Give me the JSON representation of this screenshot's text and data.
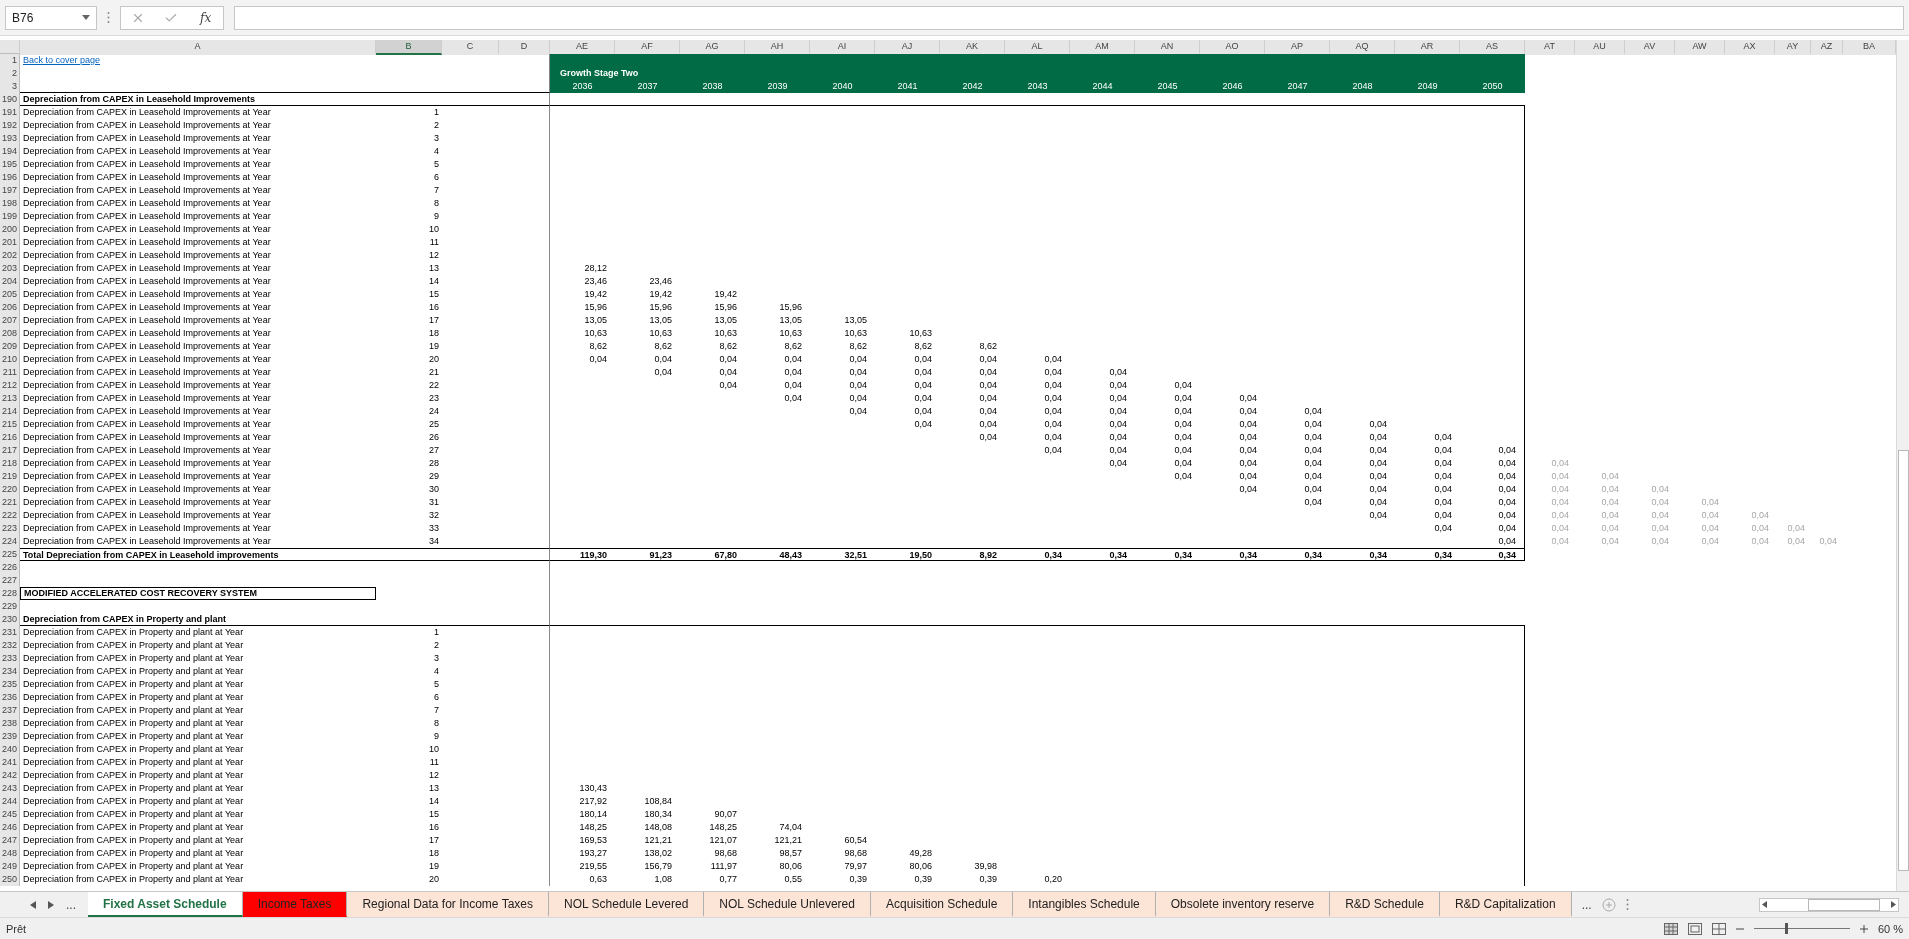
{
  "name_box": "B76",
  "formula_bar": {
    "function_button": "fx"
  },
  "column_headers": [
    {
      "label": "A",
      "selected": false
    },
    {
      "label": "B",
      "selected": true
    },
    {
      "label": "C",
      "selected": false
    },
    {
      "label": "D",
      "selected": false
    },
    {
      "label": "AE",
      "selected": false
    },
    {
      "label": "AF",
      "selected": false
    },
    {
      "label": "AG",
      "selected": false
    },
    {
      "label": "AH",
      "selected": false
    },
    {
      "label": "AI",
      "selected": false
    },
    {
      "label": "AJ",
      "selected": false
    },
    {
      "label": "AK",
      "selected": false
    },
    {
      "label": "AL",
      "selected": false
    },
    {
      "label": "AM",
      "selected": false
    },
    {
      "label": "AN",
      "selected": false
    },
    {
      "label": "AO",
      "selected": false
    },
    {
      "label": "AP",
      "selected": false
    },
    {
      "label": "AQ",
      "selected": false
    },
    {
      "label": "AR",
      "selected": false
    },
    {
      "label": "AS",
      "selected": false
    },
    {
      "label": "AT",
      "selected": false
    },
    {
      "label": "AU",
      "selected": false
    },
    {
      "label": "AV",
      "selected": false
    },
    {
      "label": "AW",
      "selected": false
    },
    {
      "label": "AX",
      "selected": false
    },
    {
      "label": "AY",
      "selected": false
    },
    {
      "label": "AZ",
      "selected": false
    },
    {
      "label": "BA",
      "selected": false
    }
  ],
  "rows": [
    {
      "row_number": "1",
      "kind": "link",
      "text": "Back to cover page"
    },
    {
      "row_number": "2",
      "kind": "band_title",
      "text": "Growth Stage Two"
    },
    {
      "row_number": "3",
      "kind": "band_years",
      "values": [
        "2036",
        "2037",
        "2038",
        "2039",
        "2040",
        "2041",
        "2042",
        "2043",
        "2044",
        "2045",
        "2046",
        "2047",
        "2048",
        "2049",
        "2050"
      ]
    },
    {
      "row_number": "190",
      "kind": "section",
      "text": "Depreciation from CAPEX in Leasehold Improvements"
    },
    {
      "row_number": "191",
      "kind": "item",
      "label": "Depreciation from CAPEX in Leasehold Improvements at Year",
      "year": "1"
    },
    {
      "row_number": "192",
      "kind": "item",
      "label": "Depreciation from CAPEX in Leasehold Improvements at Year",
      "year": "2"
    },
    {
      "row_number": "193",
      "kind": "item",
      "label": "Depreciation from CAPEX in Leasehold Improvements at Year",
      "year": "3"
    },
    {
      "row_number": "194",
      "kind": "item",
      "label": "Depreciation from CAPEX in Leasehold Improvements at Year",
      "year": "4"
    },
    {
      "row_number": "195",
      "kind": "item",
      "label": "Depreciation from CAPEX in Leasehold Improvements at Year",
      "year": "5"
    },
    {
      "row_number": "196",
      "kind": "item",
      "label": "Depreciation from CAPEX in Leasehold Improvements at Year",
      "year": "6"
    },
    {
      "row_number": "197",
      "kind": "item",
      "label": "Depreciation from CAPEX in Leasehold Improvements at Year",
      "year": "7"
    },
    {
      "row_number": "198",
      "kind": "item",
      "label": "Depreciation from CAPEX in Leasehold Improvements at Year",
      "year": "8"
    },
    {
      "row_number": "199",
      "kind": "item",
      "label": "Depreciation from CAPEX in Leasehold Improvements at Year",
      "year": "9"
    },
    {
      "row_number": "200",
      "kind": "item",
      "label": "Depreciation from CAPEX in Leasehold Improvements at Year",
      "year": "10"
    },
    {
      "row_number": "201",
      "kind": "item",
      "label": "Depreciation from CAPEX in Leasehold Improvements at Year",
      "year": "11"
    },
    {
      "row_number": "202",
      "kind": "item",
      "label": "Depreciation from CAPEX in Leasehold Improvements at Year",
      "year": "12"
    },
    {
      "row_number": "203",
      "kind": "item",
      "label": "Depreciation from CAPEX in Leasehold Improvements at Year",
      "year": "13",
      "values": [
        {
          "kind": "amount",
          "text": "28,12"
        }
      ]
    },
    {
      "row_number": "204",
      "kind": "item",
      "label": "Depreciation from CAPEX in Leasehold Improvements at Year",
      "year": "14",
      "values": [
        {
          "kind": "amount",
          "text": "23,46"
        },
        {
          "kind": "amount",
          "text": "23,46"
        }
      ]
    },
    {
      "row_number": "205",
      "kind": "item",
      "label": "Depreciation from CAPEX in Leasehold Improvements at Year",
      "year": "15",
      "values": [
        {
          "kind": "amount",
          "text": "19,42"
        },
        {
          "kind": "amount",
          "text": "19,42"
        },
        {
          "kind": "amount",
          "text": "19,42"
        }
      ]
    },
    {
      "row_number": "206",
      "kind": "item",
      "label": "Depreciation from CAPEX in Leasehold Improvements at Year",
      "year": "16",
      "values": [
        {
          "kind": "amount",
          "text": "15,96"
        },
        {
          "kind": "amount",
          "text": "15,96"
        },
        {
          "kind": "amount",
          "text": "15,96"
        },
        {
          "kind": "amount",
          "text": "15,96"
        }
      ]
    },
    {
      "row_number": "207",
      "kind": "item",
      "label": "Depreciation from CAPEX in Leasehold Improvements at Year",
      "year": "17",
      "values": [
        {
          "kind": "amount",
          "text": "13,05"
        },
        {
          "kind": "amount",
          "text": "13,05"
        },
        {
          "kind": "amount",
          "text": "13,05"
        },
        {
          "kind": "amount",
          "text": "13,05"
        },
        {
          "kind": "amount",
          "text": "13,05"
        }
      ]
    },
    {
      "row_number": "208",
      "kind": "item",
      "label": "Depreciation from CAPEX in Leasehold Improvements at Year",
      "year": "18",
      "values": [
        {
          "kind": "amount",
          "text": "10,63"
        },
        {
          "kind": "amount",
          "text": "10,63"
        },
        {
          "kind": "amount",
          "text": "10,63"
        },
        {
          "kind": "amount",
          "text": "10,63"
        },
        {
          "kind": "amount",
          "text": "10,63"
        },
        {
          "kind": "amount",
          "text": "10,63"
        }
      ]
    },
    {
      "row_number": "209",
      "kind": "item",
      "label": "Depreciation from CAPEX in Leasehold Improvements at Year",
      "year": "19",
      "values": [
        {
          "kind": "amount",
          "text": "8,62"
        },
        {
          "kind": "amount",
          "text": "8,62"
        },
        {
          "kind": "amount",
          "text": "8,62"
        },
        {
          "kind": "amount",
          "text": "8,62"
        },
        {
          "kind": "amount",
          "text": "8,62"
        },
        {
          "kind": "amount",
          "text": "8,62"
        },
        {
          "kind": "amount",
          "text": "8,62"
        }
      ]
    },
    {
      "row_number": "210",
      "kind": "item",
      "label": "Depreciation from CAPEX in Leasehold Improvements at Year",
      "year": "20",
      "values": [
        {
          "kind": "amount",
          "text": "0,04"
        },
        {
          "kind": "amount",
          "text": "0,04"
        },
        {
          "kind": "amount",
          "text": "0,04"
        },
        {
          "kind": "amount",
          "text": "0,04"
        },
        {
          "kind": "amount",
          "text": "0,04"
        },
        {
          "kind": "amount",
          "text": "0,04"
        },
        {
          "kind": "amount",
          "text": "0,04"
        },
        {
          "kind": "amount",
          "text": "0,04"
        }
      ]
    },
    {
      "row_number": "211",
      "kind": "item",
      "label": "Depreciation from CAPEX in Leasehold Improvements at Year",
      "year": "21",
      "values": [
        {
          "kind": "blank"
        },
        {
          "kind": "amount",
          "text": "0,04"
        },
        {
          "kind": "amount",
          "text": "0,04"
        },
        {
          "kind": "amount",
          "text": "0,04"
        },
        {
          "kind": "amount",
          "text": "0,04"
        },
        {
          "kind": "amount",
          "text": "0,04"
        },
        {
          "kind": "amount",
          "text": "0,04"
        },
        {
          "kind": "amount",
          "text": "0,04"
        },
        {
          "kind": "amount",
          "text": "0,04"
        }
      ]
    },
    {
      "row_number": "212",
      "kind": "item",
      "label": "Depreciation from CAPEX in Leasehold Improvements at Year",
      "year": "22",
      "values": [
        {
          "kind": "blank"
        },
        {
          "kind": "blank"
        },
        {
          "kind": "amount",
          "text": "0,04"
        },
        {
          "kind": "amount",
          "text": "0,04"
        },
        {
          "kind": "amount",
          "text": "0,04"
        },
        {
          "kind": "amount",
          "text": "0,04"
        },
        {
          "kind": "amount",
          "text": "0,04"
        },
        {
          "kind": "amount",
          "text": "0,04"
        },
        {
          "kind": "amount",
          "text": "0,04"
        },
        {
          "kind": "amount",
          "text": "0,04"
        }
      ]
    },
    {
      "row_number": "213",
      "kind": "item",
      "label": "Depreciation from CAPEX in Leasehold Improvements at Year",
      "year": "23",
      "values": [
        {
          "kind": "blank"
        },
        {
          "kind": "blank"
        },
        {
          "kind": "blank"
        },
        {
          "kind": "amount",
          "text": "0,04"
        },
        {
          "kind": "amount",
          "text": "0,04"
        },
        {
          "kind": "amount",
          "text": "0,04"
        },
        {
          "kind": "amount",
          "text": "0,04"
        },
        {
          "kind": "amount",
          "text": "0,04"
        },
        {
          "kind": "amount",
          "text": "0,04"
        },
        {
          "kind": "amount",
          "text": "0,04"
        },
        {
          "kind": "amount",
          "text": "0,04"
        }
      ]
    },
    {
      "row_number": "214",
      "kind": "item",
      "label": "Depreciation from CAPEX in Leasehold Improvements at Year",
      "year": "24",
      "values": [
        {
          "kind": "blank"
        },
        {
          "kind": "blank"
        },
        {
          "kind": "blank"
        },
        {
          "kind": "blank"
        },
        {
          "kind": "amount",
          "text": "0,04"
        },
        {
          "kind": "amount",
          "text": "0,04"
        },
        {
          "kind": "amount",
          "text": "0,04"
        },
        {
          "kind": "amount",
          "text": "0,04"
        },
        {
          "kind": "amount",
          "text": "0,04"
        },
        {
          "kind": "amount",
          "text": "0,04"
        },
        {
          "kind": "amount",
          "text": "0,04"
        },
        {
          "kind": "amount",
          "text": "0,04"
        }
      ]
    },
    {
      "row_number": "215",
      "kind": "item",
      "label": "Depreciation from CAPEX in Leasehold Improvements at Year",
      "year": "25",
      "values": [
        {
          "kind": "blank"
        },
        {
          "kind": "blank"
        },
        {
          "kind": "blank"
        },
        {
          "kind": "blank"
        },
        {
          "kind": "blank"
        },
        {
          "kind": "amount",
          "text": "0,04"
        },
        {
          "kind": "amount",
          "text": "0,04"
        },
        {
          "kind": "amount",
          "text": "0,04"
        },
        {
          "kind": "amount",
          "text": "0,04"
        },
        {
          "kind": "amount",
          "text": "0,04"
        },
        {
          "kind": "amount",
          "text": "0,04"
        },
        {
          "kind": "amount",
          "text": "0,04"
        },
        {
          "kind": "amount",
          "text": "0,04"
        }
      ]
    },
    {
      "row_number": "216",
      "kind": "item",
      "label": "Depreciation from CAPEX in Leasehold Improvements at Year",
      "year": "26",
      "values": [
        {
          "kind": "blank"
        },
        {
          "kind": "blank"
        },
        {
          "kind": "blank"
        },
        {
          "kind": "blank"
        },
        {
          "kind": "blank"
        },
        {
          "kind": "blank"
        },
        {
          "kind": "amount",
          "text": "0,04"
        },
        {
          "kind": "amount",
          "text": "0,04"
        },
        {
          "kind": "amount",
          "text": "0,04"
        },
        {
          "kind": "amount",
          "text": "0,04"
        },
        {
          "kind": "amount",
          "text": "0,04"
        },
        {
          "kind": "amount",
          "text": "0,04"
        },
        {
          "kind": "amount",
          "text": "0,04"
        },
        {
          "kind": "amount",
          "text": "0,04"
        }
      ]
    },
    {
      "row_number": "217",
      "kind": "item",
      "label": "Depreciation from CAPEX in Leasehold Improvements at Year",
      "year": "27",
      "values": [
        {
          "kind": "blank"
        },
        {
          "kind": "blank"
        },
        {
          "kind": "blank"
        },
        {
          "kind": "blank"
        },
        {
          "kind": "blank"
        },
        {
          "kind": "blank"
        },
        {
          "kind": "blank"
        },
        {
          "kind": "amount",
          "text": "0,04"
        },
        {
          "kind": "amount",
          "text": "0,04"
        },
        {
          "kind": "amount",
          "text": "0,04"
        },
        {
          "kind": "amount",
          "text": "0,04"
        },
        {
          "kind": "amount",
          "text": "0,04"
        },
        {
          "kind": "amount",
          "text": "0,04"
        },
        {
          "kind": "amount",
          "text": "0,04"
        },
        {
          "kind": "amount",
          "text": "0,04"
        }
      ]
    },
    {
      "row_number": "218",
      "kind": "item",
      "label": "Depreciation from CAPEX in Leasehold Improvements at Year",
      "year": "28",
      "values": [
        {
          "kind": "blank"
        },
        {
          "kind": "blank"
        },
        {
          "kind": "blank"
        },
        {
          "kind": "blank"
        },
        {
          "kind": "blank"
        },
        {
          "kind": "blank"
        },
        {
          "kind": "blank"
        },
        {
          "kind": "blank"
        },
        {
          "kind": "amount",
          "text": "0,04"
        },
        {
          "kind": "amount",
          "text": "0,04"
        },
        {
          "kind": "amount",
          "text": "0,04"
        },
        {
          "kind": "amount",
          "text": "0,04"
        },
        {
          "kind": "amount",
          "text": "0,04"
        },
        {
          "kind": "amount",
          "text": "0,04"
        },
        {
          "kind": "amount",
          "text": "0,04"
        }
      ],
      "overflow_values": [
        "0,04"
      ]
    },
    {
      "row_number": "219",
      "kind": "item",
      "label": "Depreciation from CAPEX in Leasehold Improvements at Year",
      "year": "29",
      "values": [
        {
          "kind": "blank"
        },
        {
          "kind": "blank"
        },
        {
          "kind": "blank"
        },
        {
          "kind": "blank"
        },
        {
          "kind": "blank"
        },
        {
          "kind": "blank"
        },
        {
          "kind": "blank"
        },
        {
          "kind": "blank"
        },
        {
          "kind": "blank"
        },
        {
          "kind": "amount",
          "text": "0,04"
        },
        {
          "kind": "amount",
          "text": "0,04"
        },
        {
          "kind": "amount",
          "text": "0,04"
        },
        {
          "kind": "amount",
          "text": "0,04"
        },
        {
          "kind": "amount",
          "text": "0,04"
        },
        {
          "kind": "amount",
          "text": "0,04"
        }
      ],
      "overflow_values": [
        "0,04",
        "0,04"
      ]
    },
    {
      "row_number": "220",
      "kind": "item",
      "label": "Depreciation from CAPEX in Leasehold Improvements at Year",
      "year": "30",
      "values": [
        {
          "kind": "blank"
        },
        {
          "kind": "blank"
        },
        {
          "kind": "blank"
        },
        {
          "kind": "blank"
        },
        {
          "kind": "blank"
        },
        {
          "kind": "blank"
        },
        {
          "kind": "blank"
        },
        {
          "kind": "blank"
        },
        {
          "kind": "blank"
        },
        {
          "kind": "blank"
        },
        {
          "kind": "amount",
          "text": "0,04"
        },
        {
          "kind": "amount",
          "text": "0,04"
        },
        {
          "kind": "amount",
          "text": "0,04"
        },
        {
          "kind": "amount",
          "text": "0,04"
        },
        {
          "kind": "amount",
          "text": "0,04"
        }
      ],
      "overflow_values": [
        "0,04",
        "0,04",
        "0,04"
      ]
    },
    {
      "row_number": "221",
      "kind": "item",
      "label": "Depreciation from CAPEX in Leasehold Improvements at Year",
      "year": "31",
      "values": [
        {
          "kind": "blank"
        },
        {
          "kind": "blank"
        },
        {
          "kind": "blank"
        },
        {
          "kind": "blank"
        },
        {
          "kind": "blank"
        },
        {
          "kind": "blank"
        },
        {
          "kind": "blank"
        },
        {
          "kind": "blank"
        },
        {
          "kind": "blank"
        },
        {
          "kind": "blank"
        },
        {
          "kind": "blank"
        },
        {
          "kind": "amount",
          "text": "0,04"
        },
        {
          "kind": "amount",
          "text": "0,04"
        },
        {
          "kind": "amount",
          "text": "0,04"
        },
        {
          "kind": "amount",
          "text": "0,04"
        }
      ],
      "overflow_values": [
        "0,04",
        "0,04",
        "0,04",
        "0,04"
      ]
    },
    {
      "row_number": "222",
      "kind": "item",
      "label": "Depreciation from CAPEX in Leasehold Improvements at Year",
      "year": "32",
      "values": [
        {
          "kind": "blank"
        },
        {
          "kind": "blank"
        },
        {
          "kind": "blank"
        },
        {
          "kind": "blank"
        },
        {
          "kind": "blank"
        },
        {
          "kind": "blank"
        },
        {
          "kind": "blank"
        },
        {
          "kind": "blank"
        },
        {
          "kind": "blank"
        },
        {
          "kind": "blank"
        },
        {
          "kind": "blank"
        },
        {
          "kind": "blank"
        },
        {
          "kind": "amount",
          "text": "0,04"
        },
        {
          "kind": "amount",
          "text": "0,04"
        },
        {
          "kind": "amount",
          "text": "0,04"
        }
      ],
      "overflow_values": [
        "0,04",
        "0,04",
        "0,04",
        "0,04",
        "0,04"
      ]
    },
    {
      "row_number": "223",
      "kind": "item",
      "label": "Depreciation from CAPEX in Leasehold Improvements at Year",
      "year": "33",
      "values": [
        {
          "kind": "blank"
        },
        {
          "kind": "blank"
        },
        {
          "kind": "blank"
        },
        {
          "kind": "blank"
        },
        {
          "kind": "blank"
        },
        {
          "kind": "blank"
        },
        {
          "kind": "blank"
        },
        {
          "kind": "blank"
        },
        {
          "kind": "blank"
        },
        {
          "kind": "blank"
        },
        {
          "kind": "blank"
        },
        {
          "kind": "blank"
        },
        {
          "kind": "blank"
        },
        {
          "kind": "amount",
          "text": "0,04"
        },
        {
          "kind": "amount",
          "text": "0,04"
        }
      ],
      "overflow_values": [
        "0,04",
        "0,04",
        "0,04",
        "0,04",
        "0,04",
        "0,04"
      ]
    },
    {
      "row_number": "224",
      "kind": "item",
      "label": "Depreciation from CAPEX in Leasehold Improvements at Year",
      "year": "34",
      "values": [
        {
          "kind": "blank"
        },
        {
          "kind": "blank"
        },
        {
          "kind": "blank"
        },
        {
          "kind": "blank"
        },
        {
          "kind": "blank"
        },
        {
          "kind": "blank"
        },
        {
          "kind": "blank"
        },
        {
          "kind": "blank"
        },
        {
          "kind": "blank"
        },
        {
          "kind": "blank"
        },
        {
          "kind": "blank"
        },
        {
          "kind": "blank"
        },
        {
          "kind": "blank"
        },
        {
          "kind": "blank"
        },
        {
          "kind": "amount",
          "text": "0,04"
        }
      ],
      "overflow_values": [
        "0,04",
        "0,04",
        "0,04",
        "0,04",
        "0,04",
        "0,04",
        "0,04"
      ]
    },
    {
      "row_number": "225",
      "kind": "total",
      "label": "Total Depreciation from CAPEX in Leasehold improvements",
      "values": [
        "119,30",
        "91,23",
        "67,80",
        "48,43",
        "32,51",
        "19,50",
        "8,92",
        "0,34",
        "0,34",
        "0,34",
        "0,34",
        "0,34",
        "0,34",
        "0,34",
        "0,34"
      ]
    },
    {
      "row_number": "226",
      "kind": "blank"
    },
    {
      "row_number": "227",
      "kind": "blank"
    },
    {
      "row_number": "228",
      "kind": "boxed_title",
      "text": "MODIFIED  ACCELERATED COST RECOVERY SYSTEM"
    },
    {
      "row_number": "229",
      "kind": "blank"
    },
    {
      "row_number": "230",
      "kind": "section",
      "text": "Depreciation from CAPEX in Property and plant"
    },
    {
      "row_number": "231",
      "kind": "item",
      "label": "Depreciation from CAPEX in Property and plant at Year",
      "year": "1"
    },
    {
      "row_number": "232",
      "kind": "item",
      "label": "Depreciation from CAPEX in Property and plant at Year",
      "year": "2"
    },
    {
      "row_number": "233",
      "kind": "item",
      "label": "Depreciation from CAPEX in Property and plant at Year",
      "year": "3"
    },
    {
      "row_number": "234",
      "kind": "item",
      "label": "Depreciation from CAPEX in Property and plant at Year",
      "year": "4"
    },
    {
      "row_number": "235",
      "kind": "item",
      "label": "Depreciation from CAPEX in Property and plant at Year",
      "year": "5"
    },
    {
      "row_number": "236",
      "kind": "item",
      "label": "Depreciation from CAPEX in Property and plant at Year",
      "year": "6"
    },
    {
      "row_number": "237",
      "kind": "item",
      "label": "Depreciation from CAPEX in Property and plant at Year",
      "year": "7"
    },
    {
      "row_number": "238",
      "kind": "item",
      "label": "Depreciation from CAPEX in Property and plant at Year",
      "year": "8"
    },
    {
      "row_number": "239",
      "kind": "item",
      "label": "Depreciation from CAPEX in Property and plant at Year",
      "year": "9"
    },
    {
      "row_number": "240",
      "kind": "item",
      "label": "Depreciation from CAPEX in Property and plant at Year",
      "year": "10"
    },
    {
      "row_number": "241",
      "kind": "item",
      "label": "Depreciation from CAPEX in Property and plant at Year",
      "year": "11"
    },
    {
      "row_number": "242",
      "kind": "item",
      "label": "Depreciation from CAPEX in Property and plant at Year",
      "year": "12"
    },
    {
      "row_number": "243",
      "kind": "item",
      "label": "Depreciation from CAPEX in Property and plant at Year",
      "year": "13",
      "values": [
        {
          "kind": "amount",
          "text": "130,43"
        }
      ]
    },
    {
      "row_number": "244",
      "kind": "item",
      "label": "Depreciation from CAPEX in Property and plant at Year",
      "year": "14",
      "values": [
        {
          "kind": "amount",
          "text": "217,92"
        },
        {
          "kind": "amount",
          "text": "108,84"
        }
      ]
    },
    {
      "row_number": "245",
      "kind": "item",
      "label": "Depreciation from CAPEX in Property and plant at Year",
      "year": "15",
      "values": [
        {
          "kind": "amount",
          "text": "180,14"
        },
        {
          "kind": "amount",
          "text": "180,34"
        },
        {
          "kind": "amount",
          "text": "90,07"
        }
      ]
    },
    {
      "row_number": "246",
      "kind": "item",
      "label": "Depreciation from CAPEX in Property and plant at Year",
      "year": "16",
      "values": [
        {
          "kind": "amount",
          "text": "148,25"
        },
        {
          "kind": "amount",
          "text": "148,08"
        },
        {
          "kind": "amount",
          "text": "148,25"
        },
        {
          "kind": "amount",
          "text": "74,04"
        }
      ]
    },
    {
      "row_number": "247",
      "kind": "item",
      "label": "Depreciation from CAPEX in Property and plant at Year",
      "year": "17",
      "values": [
        {
          "kind": "amount",
          "text": "169,53"
        },
        {
          "kind": "amount",
          "text": "121,21"
        },
        {
          "kind": "amount",
          "text": "121,07"
        },
        {
          "kind": "amount",
          "text": "121,21"
        },
        {
          "kind": "amount",
          "text": "60,54"
        }
      ]
    },
    {
      "row_number": "248",
      "kind": "item",
      "label": "Depreciation from CAPEX in Property and plant at Year",
      "year": "18",
      "values": [
        {
          "kind": "amount",
          "text": "193,27"
        },
        {
          "kind": "amount",
          "text": "138,02"
        },
        {
          "kind": "amount",
          "text": "98,68"
        },
        {
          "kind": "amount",
          "text": "98,57"
        },
        {
          "kind": "amount",
          "text": "98,68"
        },
        {
          "kind": "amount",
          "text": "49,28"
        }
      ]
    },
    {
      "row_number": "249",
      "kind": "item",
      "label": "Depreciation from CAPEX in Property and plant at Year",
      "year": "19",
      "values": [
        {
          "kind": "amount",
          "text": "219,55"
        },
        {
          "kind": "amount",
          "text": "156,79"
        },
        {
          "kind": "amount",
          "text": "111,97"
        },
        {
          "kind": "amount",
          "text": "80,06"
        },
        {
          "kind": "amount",
          "text": "79,97"
        },
        {
          "kind": "amount",
          "text": "80,06"
        },
        {
          "kind": "amount",
          "text": "39,98"
        }
      ]
    },
    {
      "row_number": "250",
      "kind": "item",
      "label": "Depreciation from CAPEX in Property and plant at Year",
      "year": "20",
      "values": [
        {
          "kind": "amount",
          "text": "0,63"
        },
        {
          "kind": "amount",
          "text": "1,08"
        },
        {
          "kind": "amount",
          "text": "0,77"
        },
        {
          "kind": "amount",
          "text": "0,55"
        },
        {
          "kind": "amount",
          "text": "0,39"
        },
        {
          "kind": "amount",
          "text": "0,39"
        },
        {
          "kind": "amount",
          "text": "0,39"
        },
        {
          "kind": "amount",
          "text": "0,20"
        }
      ]
    }
  ],
  "sheet_tabs": {
    "left_more": "...",
    "right_more": "...",
    "tabs": [
      {
        "label": "Fixed Asset Schedule",
        "selected": true
      },
      {
        "label": "Income Taxes",
        "selected": false,
        "color": "#ff0000"
      },
      {
        "label": "Regional Data for Income Taxes",
        "selected": false,
        "color": "#fce4d6"
      },
      {
        "label": "NOL Schedule Levered",
        "selected": false,
        "color": "#fce4d6"
      },
      {
        "label": "NOL Schedule Unlevered",
        "selected": false,
        "color": "#fce4d6"
      },
      {
        "label": "Acquisition Schedule",
        "selected": false,
        "color": "#fce4d6"
      },
      {
        "label": "Intangibles Schedule",
        "selected": false,
        "color": "#fce4d6"
      },
      {
        "label": "Obsolete inventory reserve",
        "selected": false,
        "color": "#fce4d6"
      },
      {
        "label": "R&D Schedule",
        "selected": false,
        "color": "#fce4d6"
      },
      {
        "label": "R&D Capitalization",
        "selected": false,
        "color": "#fce4d6"
      }
    ]
  },
  "status_bar": {
    "status": "Prêt",
    "zoom": {
      "level": 0.33,
      "reading": "60 %"
    }
  }
}
